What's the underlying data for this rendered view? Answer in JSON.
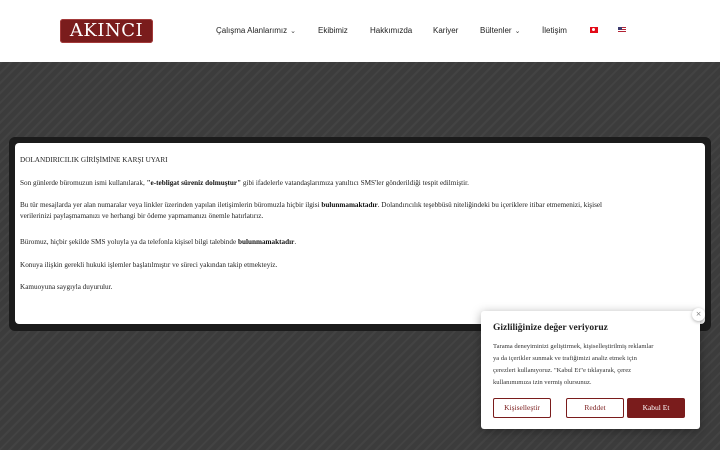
{
  "header": {
    "logo_text": "AKINCI",
    "nav": [
      {
        "label": "Çalışma Alanlarımız",
        "dropdown": true
      },
      {
        "label": "Ekibimiz",
        "dropdown": false
      },
      {
        "label": "Hakkımızda",
        "dropdown": false
      },
      {
        "label": "Kariyer",
        "dropdown": false
      },
      {
        "label": "Bültenler",
        "dropdown": true
      },
      {
        "label": "İletişim",
        "dropdown": false
      }
    ],
    "languages": [
      {
        "name": "tr-flag-icon"
      },
      {
        "name": "us-flag-icon"
      }
    ]
  },
  "notice": {
    "title": "DOLANDIRICILIK GİRİŞİMİNE KARŞI UYARI",
    "p1_pre": "Son günlerde büromuzun ismi kullanılarak, ",
    "p1_bold": "\"e-tebligat süreniz dolmuştur\"",
    "p1_post": " gibi ifadelerle vatandaşlarımıza yanıltıcı SMS'ler gönderildiği tespit edilmiştir.",
    "p2_pre": "Bu tür mesajlarda yer alan numaralar veya linkler üzerinden yapılan iletişimlerin büromuzla hiçbir ilgisi ",
    "p2_bold": "bulunmamaktadır",
    "p2_post": ". Dolandırıcılık teşebbüsü niteliğindeki bu içeriklere itibar etmemenizi, kişisel",
    "p2_line2": "verilerinizi paylaşmamanızı ve herhangi bir ödeme yapmamanızı önemle hatırlatırız.",
    "p3_pre": "Büromuz, hiçbir şekilde SMS yoluyla ya da telefonla kişisel bilgi talebinde ",
    "p3_bold": "bulunmamaktadır",
    "p3_post": ".",
    "p4": "Konuya ilişkin gerekli hukuki işlemler başlatılmıştır ve süreci yakından takip etmekteyiz.",
    "p5": "Kamuoyuna saygıyla duyurulur."
  },
  "cookie": {
    "close": "×",
    "title": "Gizliliğinize değer veriyoruz",
    "lines": [
      "Tarama deneyiminizi geliştirmek, kişiselleştirilmiş reklamlar",
      "ya da içerikler sunmak ve trafiğimizi analiz etmek için",
      "çerezleri kullanıyoruz. \"Kabul Et\"e tıklayarak, çerez",
      "kullanımımıza izin vermiş olursunuz."
    ],
    "btn_customize": "Kişiselleştir",
    "btn_reject": "Reddet",
    "btn_accept": "Kabul Et"
  },
  "colors": {
    "brand": "#7a1c1c",
    "background": "#3c3c3c"
  }
}
